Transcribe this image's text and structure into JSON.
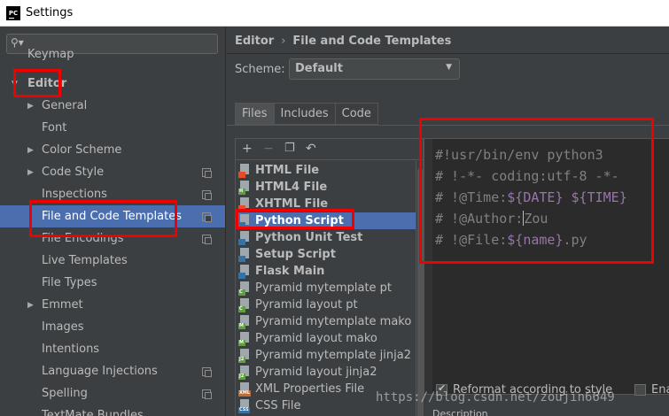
{
  "window": {
    "app_icon": "PC",
    "title": "Settings"
  },
  "sidebar": {
    "search_icon": "search-icon",
    "items": [
      {
        "label": "Keymap"
      },
      {
        "label": "Editor"
      },
      {
        "label": "General"
      },
      {
        "label": "Font"
      },
      {
        "label": "Color Scheme"
      },
      {
        "label": "Code Style"
      },
      {
        "label": "Inspections"
      },
      {
        "label": "File and Code Templates"
      },
      {
        "label": "File Encodings"
      },
      {
        "label": "Live Templates"
      },
      {
        "label": "File Types"
      },
      {
        "label": "Emmet"
      },
      {
        "label": "Images"
      },
      {
        "label": "Intentions"
      },
      {
        "label": "Language Injections"
      },
      {
        "label": "Spelling"
      },
      {
        "label": "TextMate Bundles"
      }
    ]
  },
  "breadcrumb": {
    "parent": "Editor",
    "separator": "›",
    "current": "File and Code Templates"
  },
  "scheme": {
    "label": "Scheme:",
    "value": "Default"
  },
  "tabs": [
    {
      "label": "Files"
    },
    {
      "label": "Includes"
    },
    {
      "label": "Code"
    }
  ],
  "templates": [
    {
      "name": "HTML File",
      "tag": "",
      "tag_color": "#e44d26"
    },
    {
      "name": "HTML4 File",
      "tag": "H",
      "tag_color": "#5f9f3f"
    },
    {
      "name": "XHTML File",
      "tag": "",
      "tag_color": "#e44d26"
    },
    {
      "name": "Python Script",
      "tag": "",
      "tag_color": "#3572a5"
    },
    {
      "name": "Python Unit Test",
      "tag": "",
      "tag_color": "#3572a5"
    },
    {
      "name": "Setup Script",
      "tag": "",
      "tag_color": "#3572a5"
    },
    {
      "name": "Flask Main",
      "tag": "",
      "tag_color": "#3572a5"
    },
    {
      "name": "Pyramid mytemplate pt",
      "tag": "C",
      "tag_color": "#5f9f3f"
    },
    {
      "name": "Pyramid layout pt",
      "tag": "C",
      "tag_color": "#5f9f3f"
    },
    {
      "name": "Pyramid mytemplate mako",
      "tag": "M",
      "tag_color": "#5f9f3f"
    },
    {
      "name": "Pyramid layout mako",
      "tag": "M",
      "tag_color": "#5f9f3f"
    },
    {
      "name": "Pyramid mytemplate jinja2",
      "tag": "J2",
      "tag_color": "#5f9f3f"
    },
    {
      "name": "Pyramid layout jinja2",
      "tag": "J2",
      "tag_color": "#5f9f3f"
    },
    {
      "name": "XML Properties File",
      "tag": "XML",
      "tag_color": "#c36b2e"
    },
    {
      "name": "CSS File",
      "tag": "CSS",
      "tag_color": "#3572a5"
    }
  ],
  "editor": {
    "lines": [
      [
        {
          "t": "#!usr/bin/env python3",
          "v": false
        }
      ],
      [
        {
          "t": "# !-*- coding:utf-8 -*-",
          "v": false
        }
      ],
      [
        {
          "t": "# !@Time:",
          "v": false
        },
        {
          "t": "${DATE}",
          "v": true
        },
        {
          "t": " ",
          "v": false
        },
        {
          "t": "${TIME}",
          "v": true
        }
      ],
      [
        {
          "t": "# !@Author:",
          "v": false
        },
        {
          "t": "Zou",
          "v": false
        }
      ],
      [
        {
          "t": "# !@File:",
          "v": false
        },
        {
          "t": "${name}",
          "v": true
        },
        {
          "t": ".py",
          "v": false
        }
      ]
    ]
  },
  "options": {
    "reformat_label": "Reformat according to style",
    "reformat_checked": true,
    "enable_label": "Ena",
    "description_label": "Description"
  },
  "watermark": "https://blog.csdn.net/zoujin6649"
}
